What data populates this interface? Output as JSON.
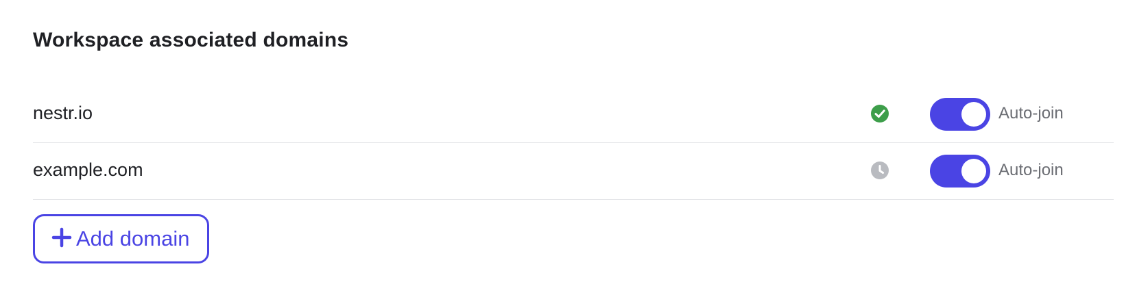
{
  "section": {
    "title": "Workspace associated domains"
  },
  "domains": [
    {
      "name": "nestr.io",
      "status": "verified",
      "status_icon": "check-circle-icon",
      "status_color": "#3d9e4a",
      "auto_join": true,
      "auto_join_label": "Auto-join"
    },
    {
      "name": "example.com",
      "status": "pending",
      "status_icon": "clock-icon",
      "status_color": "#b9bbc0",
      "auto_join": true,
      "auto_join_label": "Auto-join"
    }
  ],
  "add_button": {
    "label": "Add domain",
    "icon": "plus-icon"
  },
  "colors": {
    "accent": "#4a44e4",
    "text": "#1f2024",
    "muted_text": "#6b6d73",
    "divider": "#e4e5e8"
  }
}
